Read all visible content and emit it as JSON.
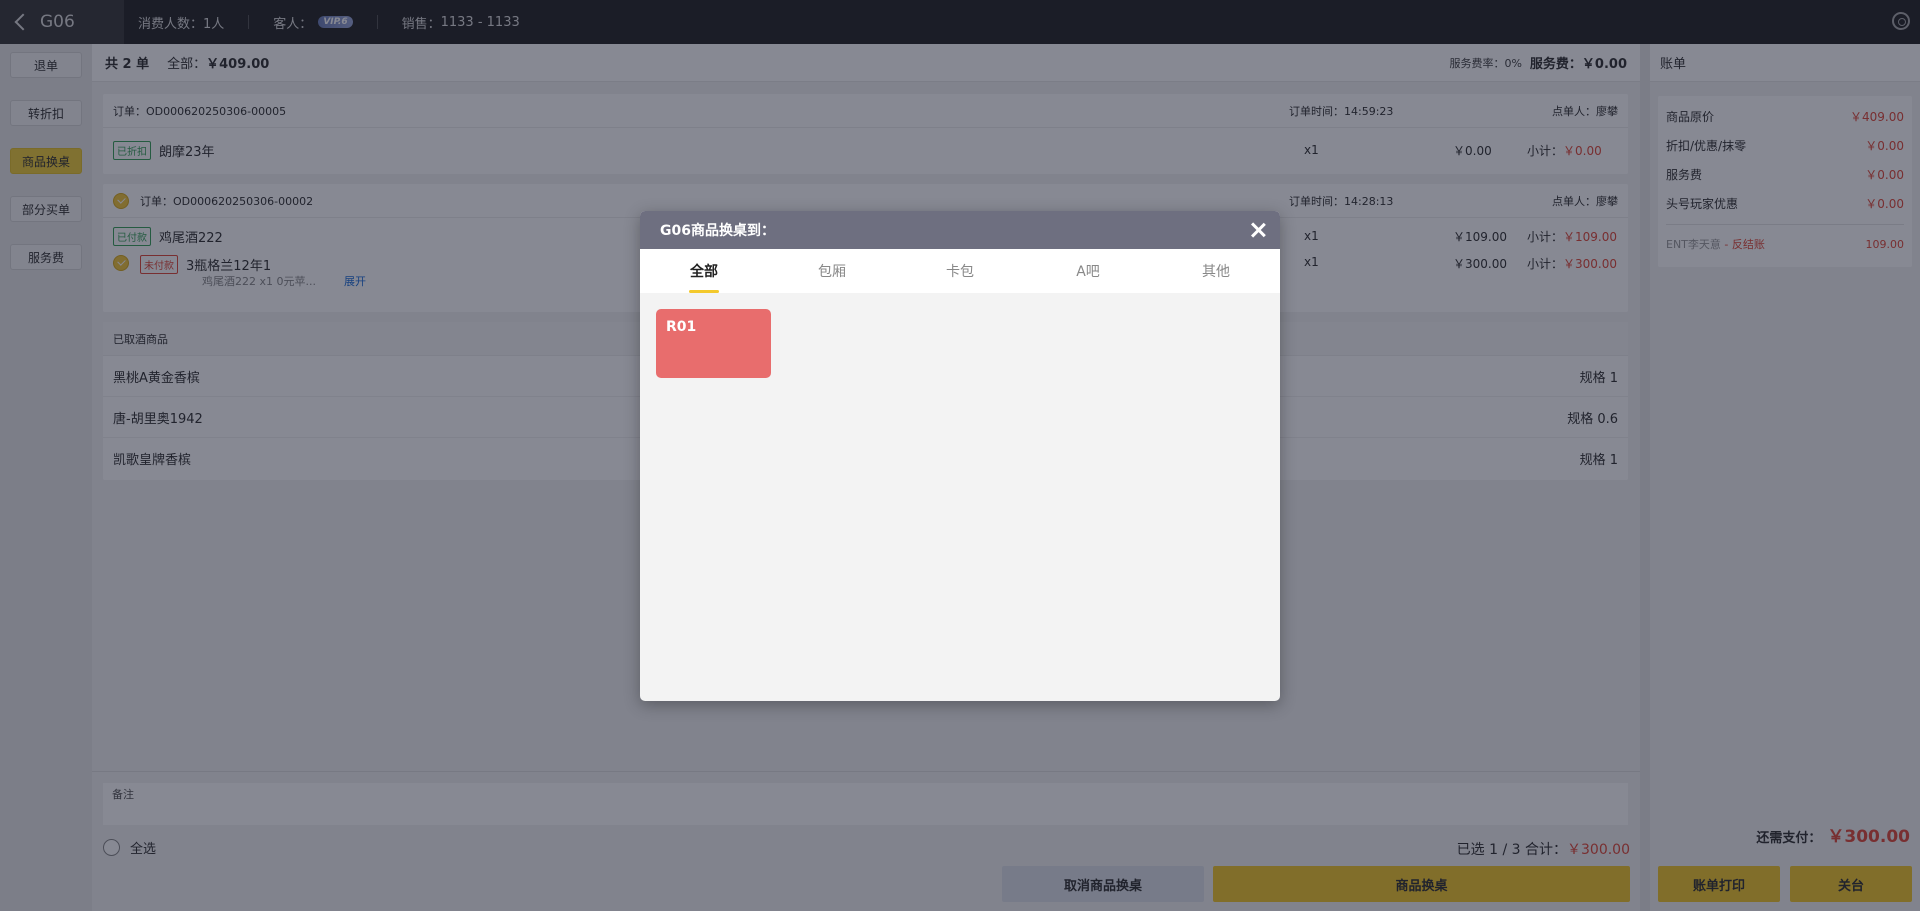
{
  "topbar": {
    "table_name": "G06",
    "guests_label": "消费人数：",
    "guests_value": "1人",
    "customer_label": "客人：",
    "vip_badge": "VIP.6",
    "sales_label": "销售：",
    "sales_value": "1133 - 1133"
  },
  "left_actions": [
    "退单",
    "转折扣",
    "商品换桌",
    "部分买单",
    "服务费"
  ],
  "summary": {
    "count_text": "共 2 单",
    "total_label": "全部：",
    "total_value": "￥409.00",
    "service_rate_label": "服务费率：",
    "service_rate_value": "0%",
    "service_fee_label": "服务费：",
    "service_fee_value": "￥0.00"
  },
  "orders": [
    {
      "order_no": "订单：OD000620250306-00005",
      "time": "订单时间：14:59:23",
      "orderer": "点单人：廖攀",
      "items": [
        {
          "tag": "已折扣",
          "name": "朗摩23年",
          "qty": "x1",
          "price": "￥0.00",
          "subtotal_label": "小计：",
          "subtotal": "￥0.00"
        }
      ]
    },
    {
      "order_no": "订单：OD000620250306-00002",
      "time": "订单时间：14:28:13",
      "orderer": "点单人：廖攀",
      "items": [
        {
          "tag": "已付款",
          "name": "鸡尾酒222",
          "qty": "x1",
          "price": "￥109.00",
          "subtotal_label": "小计：",
          "subtotal": "￥109.00"
        },
        {
          "tag": "未付款",
          "name": "3瓶格兰12年1",
          "sub": "鸡尾酒222 x1   0元苹...",
          "expand": "展开",
          "qty": "x1",
          "price": "￥300.00",
          "subtotal_label": "小计：",
          "subtotal": "￥300.00"
        }
      ]
    }
  ],
  "picked": {
    "title": "已取酒商品",
    "items": [
      {
        "name": "黑桃A黄金香槟",
        "spec": "规格 1"
      },
      {
        "name": "唐-胡里奥1942",
        "spec": "规格 0.6"
      },
      {
        "name": "凯歌皇牌香槟",
        "spec": "规格 1"
      }
    ]
  },
  "remark_label": "备注",
  "select_all": "全选",
  "selected_info_prefix": "已选 1 / 3 合计：",
  "selected_info_value": "￥300.00",
  "buttons": {
    "cancel": "取消商品换桌",
    "swap": "商品换桌"
  },
  "bill": {
    "title": "账单",
    "lines": [
      {
        "label": "商品原价",
        "value": "￥409.00"
      },
      {
        "label": "折扣/优惠/抹零",
        "value": "￥0.00"
      },
      {
        "label": "服务费",
        "value": "￥0.00"
      },
      {
        "label": "头号玩家优惠",
        "value": "￥0.00"
      }
    ],
    "note_name": "ENT李天意",
    "note_status": " - 反结账",
    "note_value": "109.00",
    "pay_label": "还需支付：",
    "pay_value": "￥300.00",
    "print_btn": "账单打印",
    "close_btn": "关台"
  },
  "modal": {
    "title": "G06商品换桌到：",
    "tabs": [
      "全部",
      "包厢",
      "卡包",
      "A吧",
      "其他"
    ],
    "active_tab": "全部",
    "rooms": [
      "R01"
    ],
    "room_color": "#e86d6d"
  },
  "colors": {
    "accent": "#f3c92c",
    "price_red": "#e14a3a",
    "topbar": "#262626"
  }
}
